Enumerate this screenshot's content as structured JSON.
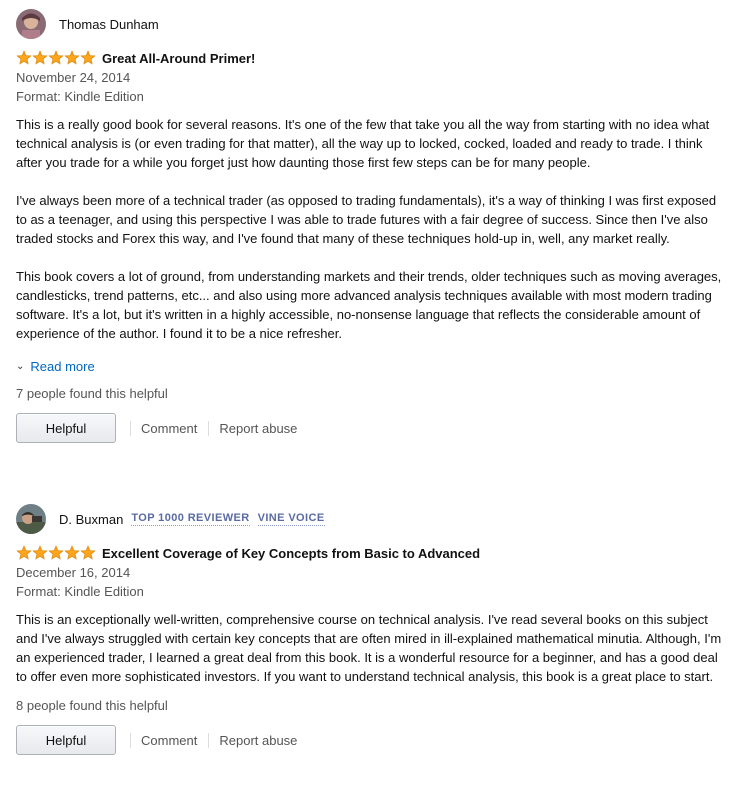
{
  "reviews": [
    {
      "reviewer": "Thomas Dunham",
      "badges": [],
      "title": "Great All-Around Primer!",
      "rating": 5,
      "date": "November 24, 2014",
      "format": "Format: Kindle Edition",
      "paragraphs": [
        "This is a really good book for several reasons. It's one of the few that take you all the way from starting with no idea what technical analysis is (or even trading for that matter), all the way up to locked, cocked, loaded and ready to trade. I think after you trade for a while you forget just how daunting those first few steps can be for many people.",
        "I've always been more of a technical trader (as opposed to trading fundamentals), it's a way of thinking I was first exposed to as a teenager, and using this perspective I was able to trade futures with a fair degree of success. Since then I've also traded stocks and Forex this way, and I've found that many of these techniques hold-up in, well, any market really.",
        "This book covers a lot of ground, from understanding markets and their trends, older techniques such as moving averages, candlesticks, trend patterns, etc... and also using more advanced analysis techniques available with most modern trading software. It's a lot, but it's written in a highly accessible, no-nonsense language that reflects the considerable amount of experience of the author. I found it to be a nice refresher."
      ],
      "read_more": "Read more",
      "helpful_count": "7 people found this helpful",
      "helpful_label": "Helpful",
      "comment_label": "Comment",
      "report_label": "Report abuse"
    },
    {
      "reviewer": "D. Buxman",
      "badges": [
        "TOP 1000 REVIEWER",
        "VINE VOICE"
      ],
      "title": "Excellent Coverage of Key Concepts from Basic to Advanced",
      "rating": 5,
      "date": "December 16, 2014",
      "format": "Format: Kindle Edition",
      "paragraphs": [
        "This is an exceptionally well-written, comprehensive course on technical analysis. I've read several books on this subject and I've always struggled with certain key concepts that are often mired in ill-explained mathematical minutia. Although, I'm an experienced trader, I learned a great deal from this book. It is a wonderful resource for a beginner, and has a good deal to offer even more sophisticated investors. If you want to understand technical analysis, this book is a great place to start."
      ],
      "helpful_count": "8 people found this helpful",
      "helpful_label": "Helpful",
      "comment_label": "Comment",
      "report_label": "Report abuse"
    }
  ],
  "colors": {
    "star": "#ffa41c",
    "link": "#0066c0",
    "badge": "#5a6ba4",
    "muted": "#555555"
  },
  "icons": {
    "star": "star-icon",
    "expand": "chevron-down-icon",
    "avatar": "avatar"
  }
}
